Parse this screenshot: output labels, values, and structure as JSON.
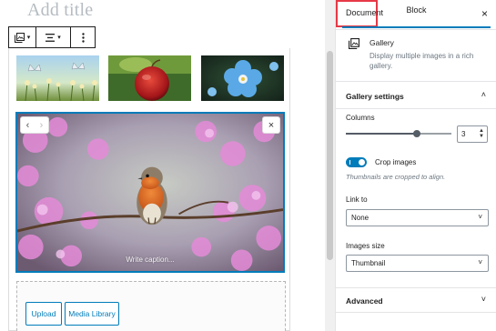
{
  "editor": {
    "title_placeholder": "Add title",
    "caption_placeholder": "Write caption...",
    "buttons": {
      "upload": "Upload",
      "media_library": "Media Library"
    },
    "toolbar_icons": [
      "gallery-block-icon",
      "align-icon",
      "more-options-icon"
    ]
  },
  "sidebar": {
    "tabs": {
      "document": "Document",
      "block": "Block"
    },
    "close_glyph": "×",
    "block_card": {
      "name": "Gallery",
      "description": "Display multiple images in a rich gallery."
    },
    "gallery_settings": {
      "title": "Gallery settings",
      "columns_label": "Columns",
      "columns_value": "3",
      "columns_slider_fraction": 0.67,
      "crop_label": "Crop images",
      "crop_help": "Thumbnails are cropped to align.",
      "crop_enabled": true,
      "link_to_label": "Link to",
      "link_to_value": "None",
      "images_size_label": "Images size",
      "images_size_value": "Thumbnail"
    },
    "advanced": {
      "title": "Advanced"
    }
  },
  "colors": {
    "accent": "#007cba",
    "highlight": "#e63946"
  }
}
